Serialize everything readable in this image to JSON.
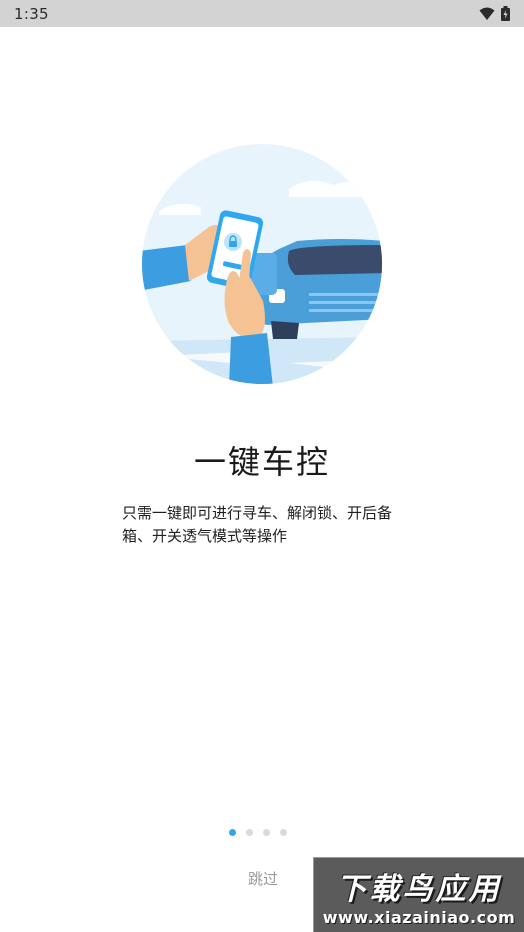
{
  "status_bar": {
    "time": "1:35",
    "icons": [
      "wifi-icon",
      "battery-icon"
    ]
  },
  "onboarding": {
    "title": "一键车控",
    "description": "只需一键即可进行寻车、解闭锁、开后备箱、开关透气模式等操作",
    "illustration": "phone-unlock-car-illustration",
    "pager": {
      "total": 4,
      "active": 1
    },
    "skip_label": "跳过"
  },
  "watermark": {
    "logo_text": "下载鸟应用",
    "url": "www.xiazainiao.com"
  },
  "colors": {
    "accent": "#2fa7f0",
    "car": "#4a9fd8",
    "sky": "#e6f3fb",
    "skin": "#f5c393",
    "sleeve": "#3c9ee0"
  }
}
